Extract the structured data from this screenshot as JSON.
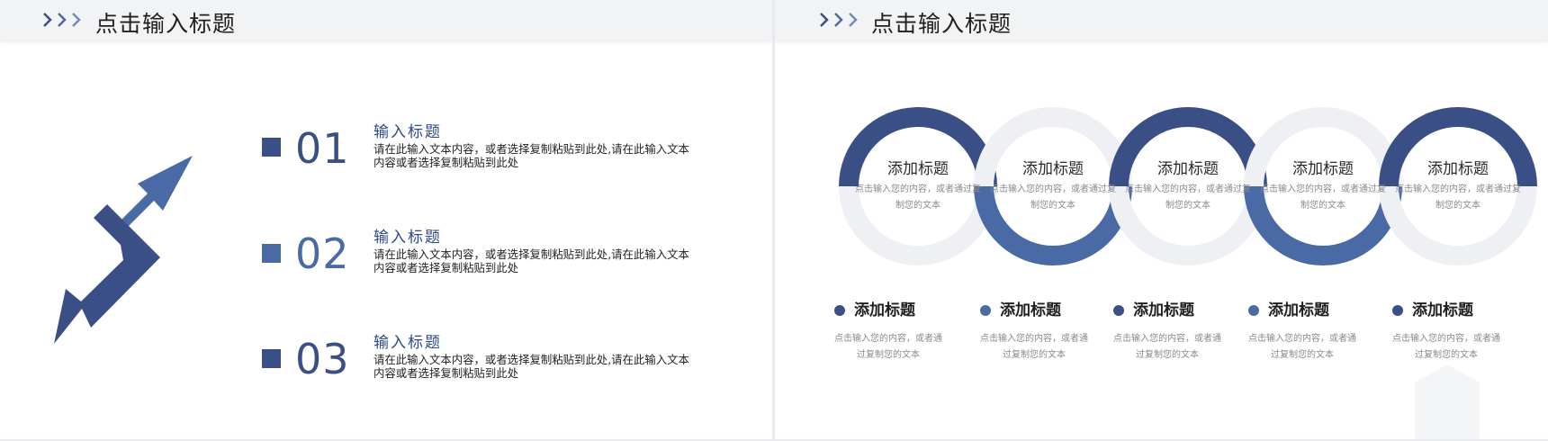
{
  "left": {
    "header": {
      "title": "点击输入标题"
    },
    "items": [
      {
        "number": "01",
        "title": "输入标题",
        "desc": "请在此输入文本内容，或者选择复制粘贴到此处,请在此输入文本内容或者选择复制粘贴到此处"
      },
      {
        "number": "02",
        "title": "输入标题",
        "desc": "请在此输入文本内容，或者选择复制粘贴到此处,请在此输入文本内容或者选择复制粘贴到此处"
      },
      {
        "number": "03",
        "title": "输入标题",
        "desc": "请在此输入文本内容，或者选择复制粘贴到此处,请在此输入文本内容或者选择复制粘贴到此处"
      }
    ]
  },
  "right": {
    "header": {
      "title": "点击输入标题"
    },
    "rings": [
      {
        "title": "添加标题",
        "desc": "点击输入您的内容，或者通过复制您的文本"
      },
      {
        "title": "添加标题",
        "desc": "点击输入您的内容，或者通过复制您的文本"
      },
      {
        "title": "添加标题",
        "desc": "点击输入您的内容，或者通过复制您的文本"
      },
      {
        "title": "添加标题",
        "desc": "点击输入您的内容，或者通过复制您的文本"
      },
      {
        "title": "添加标题",
        "desc": "点击输入您的内容，或者通过复制您的文本"
      }
    ],
    "items": [
      {
        "title": "添加标题",
        "desc": "点击输入您的内容，或者通过复制您的文本"
      },
      {
        "title": "添加标题",
        "desc": "点击输入您的内容，或者通过复制您的文本"
      },
      {
        "title": "添加标题",
        "desc": "点击输入您的内容，或者通过复制您的文本"
      },
      {
        "title": "添加标题",
        "desc": "点击输入您的内容，或者通过复制您的文本"
      },
      {
        "title": "添加标题",
        "desc": "点击输入您的内容，或者通过复制您的文本"
      }
    ]
  },
  "colors": {
    "dark_blue": "#3a4f86",
    "mid_blue": "#4a6aa6",
    "ring_gray": "#eef0f3",
    "header_bg": "#f2f3f5"
  },
  "icons": [
    "chevron-right-icon",
    "double-arrow-icon",
    "square-bullet-icon",
    "dot-bullet-icon"
  ]
}
